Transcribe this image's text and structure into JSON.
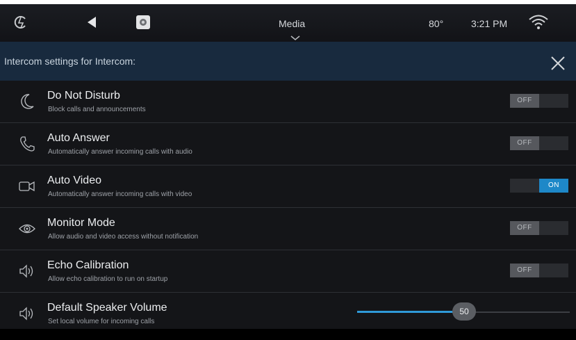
{
  "status_bar": {
    "back_app_icon": "app-logo-icon",
    "back_icon": "back-triangle-icon",
    "camera_icon": "camera-app-icon",
    "media_label": "Media",
    "temperature": "80°",
    "time": "3:21 PM",
    "wifi_icon": "wifi-icon"
  },
  "header": {
    "title": "Intercom settings for Intercom:",
    "close_icon": "close-icon"
  },
  "settings": [
    {
      "title": "Do Not Disturb",
      "subtitle": "Block calls and announcements",
      "icon": "moon-icon",
      "state": "OFF"
    },
    {
      "title": "Auto Answer",
      "subtitle": "Automatically answer incoming calls with audio",
      "icon": "phone-icon",
      "state": "OFF"
    },
    {
      "title": "Auto Video",
      "subtitle": "Automatically answer incoming calls with video",
      "icon": "video-camera-icon",
      "state": "ON"
    },
    {
      "title": "Monitor Mode",
      "subtitle": "Allow audio and video access without notification",
      "icon": "eye-icon",
      "state": "OFF"
    },
    {
      "title": "Echo Calibration",
      "subtitle": "Allow echo calibration to run on startup",
      "icon": "speaker-icon",
      "state": "OFF"
    }
  ],
  "volume": {
    "title": "Default Speaker Volume",
    "subtitle": "Set local volume for incoming calls",
    "icon": "speaker-icon",
    "value": "50",
    "fraction": 0.5
  },
  "colors": {
    "accent": "#1e88c8",
    "header_bg": "#182a3e",
    "row_bg": "#141518"
  }
}
